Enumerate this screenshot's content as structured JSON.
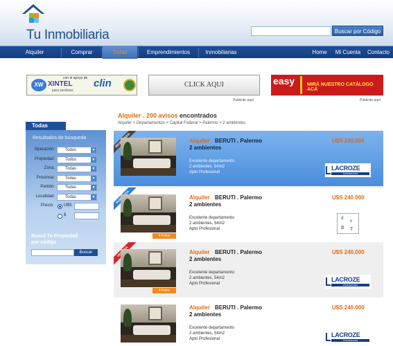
{
  "header": {
    "brand": "Tu Inmobiliaria",
    "search_button": "Buscar por Código"
  },
  "nav": {
    "left": [
      "Alquiler",
      "Comprar",
      "Todas",
      "Emprendimientos",
      "Inmobiliarias"
    ],
    "right": [
      "Home",
      "Mi Cuenta",
      "Contacto"
    ],
    "active": "Todas"
  },
  "banners": {
    "b1": {
      "xw": "XW",
      "con_apoyo": "con el apoyo de",
      "xintel": "XINTEL",
      "sub": "para windows",
      "clin": "clin"
    },
    "b2": {
      "text": "CLICK AQUI"
    },
    "b3": {
      "easy": "easy",
      "cta": "MIRÁ NUESTRO CATÁLOGO ACÁ"
    },
    "publicite": "Publicite aquí"
  },
  "sidebar": {
    "tab": "Todas",
    "heading": "Resultados de búsqueda",
    "filters": [
      {
        "label": "Operación:",
        "value": "Todos"
      },
      {
        "label": "Propiedad:",
        "value": "Todos"
      },
      {
        "label": "Zona:",
        "value": "Todas"
      },
      {
        "label": "Provincia:",
        "value": "Todas"
      },
      {
        "label": "Partido:",
        "value": "Todas"
      },
      {
        "label": "Localidad:",
        "value": "Todas"
      }
    ],
    "price_label": "Precio:",
    "currency_usd": "U$S",
    "currency_ars": "$",
    "code_title": "Buscá Tu Propiedad por código",
    "code_button": "Buscar"
  },
  "results": {
    "title_prefix": "Alquiler . 200 avisos",
    "title_suffix": " encontrados",
    "breadcrumb": "Alquiler > Departamentos > Capital Federal > Palermo > 2 ambientes",
    "cards": [
      {
        "ribbon": "RESERVADA",
        "ribbon_color": "#4a4a4a",
        "op": "Alquiler",
        "loc": "BERUTI . Palermo",
        "amb": "2 ambientes",
        "price": "U$S 240.000",
        "desc": [
          "Excelente departamento",
          "2 ambientes, 54m2",
          "Apto Profesional"
        ],
        "agency": "lacroze",
        "fotos": ""
      },
      {
        "ribbon": "SUPERADA",
        "ribbon_color": "#2f7fd2",
        "op": "Alquiler",
        "loc": "BERUTI . Palermo",
        "amb": "2 ambientes",
        "price": "U$S 240.000",
        "desc": [
          "Excelente departamento",
          "2 ambientes, 54m2",
          "Apto Profesional"
        ],
        "agency": "det",
        "fotos": "4 Fotos"
      },
      {
        "ribbon": "VENDIDA",
        "ribbon_color": "#d6272d",
        "op": "Alquiler",
        "loc": "BERUTI . Palermo",
        "amb": "2 ambientes",
        "price": "U$S 240.000",
        "desc": [
          "Excelente departamento",
          "2 ambientes, 54m2",
          "Apto Profesional"
        ],
        "agency": "lacroze",
        "fotos": "4 Fotos"
      },
      {
        "ribbon": "",
        "ribbon_color": "",
        "op": "Alquiler",
        "loc": "BERUTI . Palermo",
        "amb": "2 ambientes",
        "price": "U$S 240.000",
        "desc": [
          "Excelente departamento",
          "2 ambientes, 54m2",
          "Apto Profesional"
        ],
        "agency": "lacroze",
        "fotos": ""
      }
    ],
    "agency_lacroze": "LACROZE",
    "agency_lacroze_sub": "PROPIEDADES",
    "agency_det": [
      "d",
      "e",
      "B",
      "T"
    ]
  },
  "colors": {
    "brand_blue": "#1f4f9a",
    "accent_orange": "#e06a14"
  }
}
